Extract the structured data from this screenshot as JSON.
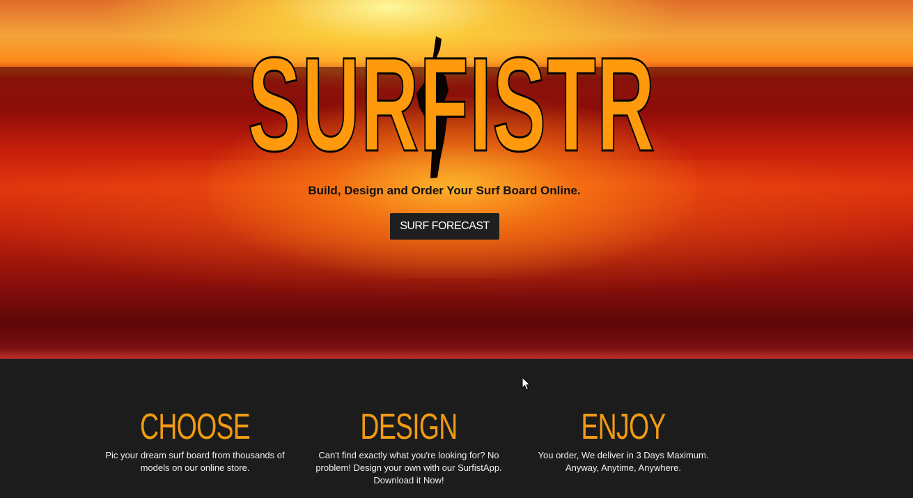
{
  "hero": {
    "brand": "SURFISTR",
    "tagline": "Build, Design and Order Your Surf Board Online.",
    "cta_label": "SURF FORECAST"
  },
  "features": [
    {
      "title": "CHOOSE",
      "text": "Pic your dream surf board from thousands of models on our online store."
    },
    {
      "title": "DESIGN",
      "text": "Can't find exactly what you're looking for? No problem! Design your own with our SurfistApp. Download it Now!"
    },
    {
      "title": "ENJOY",
      "text": "You order, We deliver in 3 Days Maximum. Anyway, Anytime, Anywhere."
    }
  ],
  "colors": {
    "accent": "#f19a13",
    "brand_fill": "#ff9a0c",
    "dark_bg": "#1c1c1c",
    "button_bg": "#1f1f1f"
  }
}
